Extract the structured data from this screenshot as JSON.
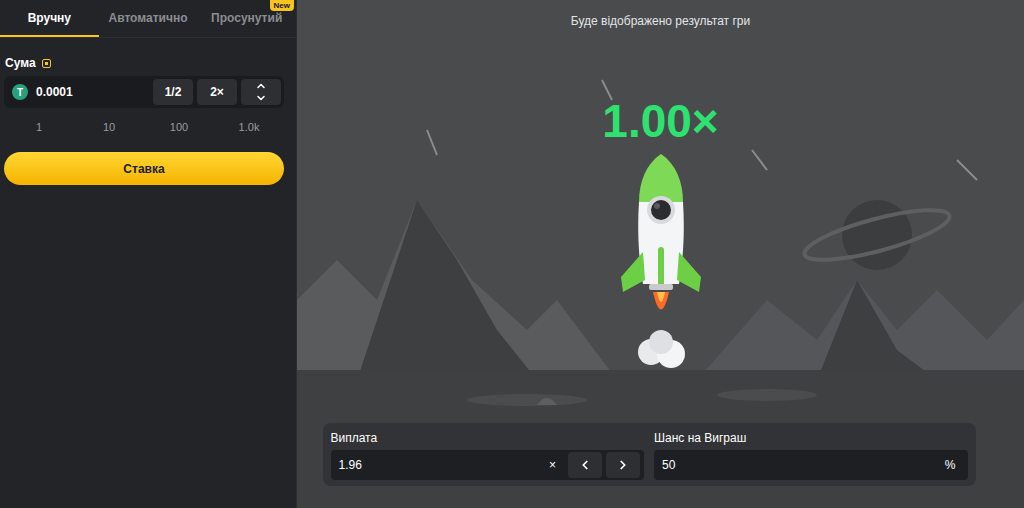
{
  "tabs": [
    {
      "label": "Вручну",
      "selected": true
    },
    {
      "label": "Автоматично",
      "selected": false
    },
    {
      "label": "Просунутий",
      "selected": false,
      "badge": "New"
    }
  ],
  "bet": {
    "label": "Сума",
    "currency_icon": "T",
    "amount": "0.0001",
    "half": "1/2",
    "double": "2×"
  },
  "quick_amounts": [
    "1",
    "10",
    "100",
    "1.0k"
  ],
  "action": "Ставка",
  "game": {
    "status": "Буде відображено результат гри",
    "multiplier": "1.00×"
  },
  "payout": {
    "label": "Виплата",
    "value": "1.96",
    "suffix": "×"
  },
  "chance": {
    "label": "Шанс на Виграш",
    "value": "50",
    "suffix": "%"
  }
}
